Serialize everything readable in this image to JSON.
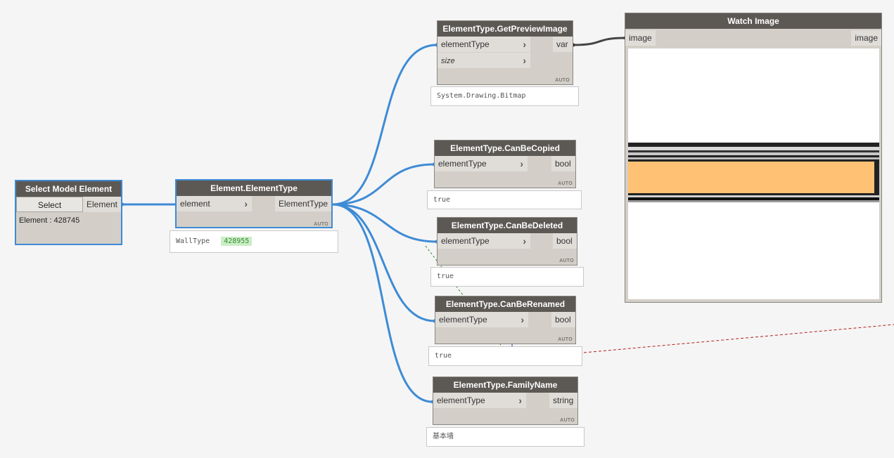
{
  "select_node": {
    "title": "Select Model Element",
    "button_label": "Select",
    "output_label": "Element",
    "element_text": "Element : 428745"
  },
  "element_type_node": {
    "title": "Element.ElementType",
    "input_label": "element",
    "output_label": "ElementType",
    "lacing": "AUTO",
    "preview_type": "WallType",
    "preview_id": "428955"
  },
  "preview_image_node": {
    "title": "ElementType.GetPreviewImage",
    "inputs": [
      "elementType",
      "size"
    ],
    "output_label": "var",
    "lacing": "AUTO",
    "preview": "System.Drawing.Bitmap"
  },
  "can_be_copied_node": {
    "title": "ElementType.CanBeCopied",
    "input_label": "elementType",
    "output_label": "bool",
    "lacing": "AUTO",
    "preview": "true"
  },
  "can_be_deleted_node": {
    "title": "ElementType.CanBeDeleted",
    "input_label": "elementType",
    "output_label": "bool",
    "lacing": "AUTO",
    "preview": "true"
  },
  "can_be_renamed_node": {
    "title": "ElementType.CanBeRenamed",
    "input_label": "elementType",
    "output_label": "bool",
    "lacing": "AUTO",
    "preview": "true"
  },
  "family_name_node": {
    "title": "ElementType.FamilyName",
    "input_label": "elementType",
    "output_label": "string",
    "lacing": "AUTO",
    "preview": "基本墙"
  },
  "watch_image_node": {
    "title": "Watch Image",
    "input_label": "image",
    "output_label": "image"
  },
  "colors": {
    "wire_blue": "#3e8bd5",
    "wire_dark": "#444444",
    "node_title": "#5c5955",
    "node_body": "#d3cfc8",
    "wall_core": "#ffc174"
  }
}
